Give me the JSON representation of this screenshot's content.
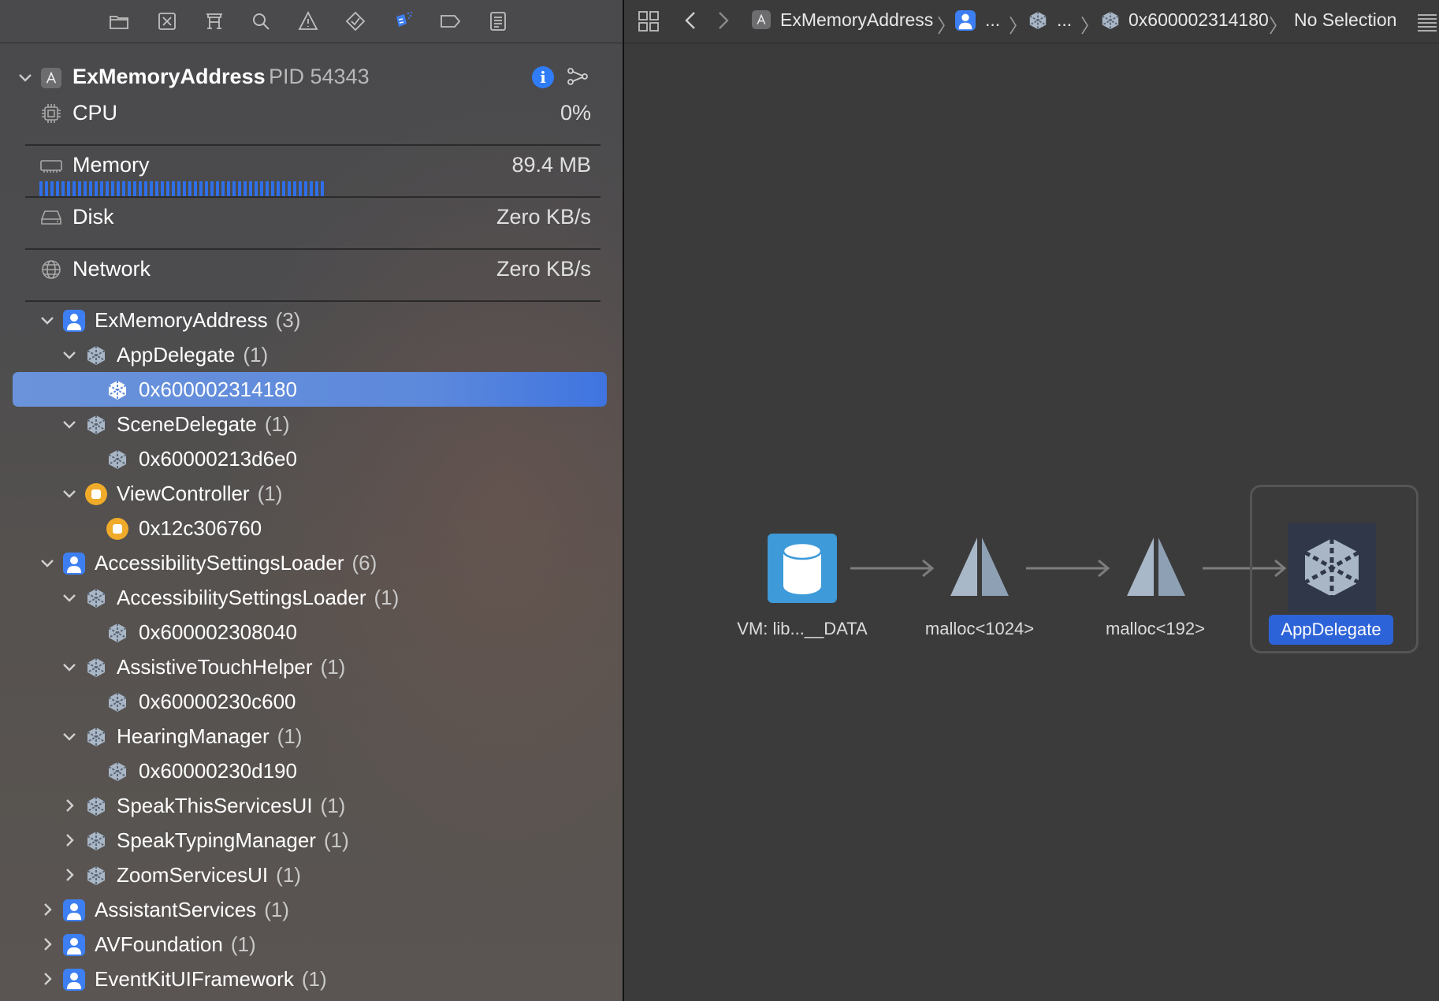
{
  "process": {
    "name": "ExMemoryAddress",
    "pid": "PID 54343",
    "info_glyph": "i"
  },
  "gauges": {
    "cpu": {
      "label": "CPU",
      "value": "0%"
    },
    "memory": {
      "label": "Memory",
      "value": "89.4 MB"
    },
    "disk": {
      "label": "Disk",
      "value": "Zero KB/s"
    },
    "network": {
      "label": "Network",
      "value": "Zero KB/s"
    }
  },
  "navigator_icons": [
    "folder-icon",
    "source-control-icon",
    "symbol-icon",
    "find-icon",
    "issue-icon",
    "test-icon",
    "debug-icon",
    "breakpoint-icon",
    "report-icon"
  ],
  "tree": {
    "r0": {
      "label": "ExMemoryAddress",
      "count": "(3)"
    },
    "r1": {
      "label": "AppDelegate",
      "count": "(1)"
    },
    "r2": {
      "label": "0x600002314180"
    },
    "r3": {
      "label": "SceneDelegate",
      "count": "(1)"
    },
    "r4": {
      "label": "0x60000213d6e0"
    },
    "r5": {
      "label": "ViewController",
      "count": "(1)"
    },
    "r6": {
      "label": "0x12c306760"
    },
    "r7": {
      "label": "AccessibilitySettingsLoader",
      "count": "(6)"
    },
    "r8": {
      "label": "AccessibilitySettingsLoader",
      "count": "(1)"
    },
    "r9": {
      "label": "0x600002308040"
    },
    "r10": {
      "label": "AssistiveTouchHelper",
      "count": "(1)"
    },
    "r11": {
      "label": "0x60000230c600"
    },
    "r12": {
      "label": "HearingManager",
      "count": "(1)"
    },
    "r13": {
      "label": "0x60000230d190"
    },
    "r14": {
      "label": "SpeakThisServicesUI",
      "count": "(1)"
    },
    "r15": {
      "label": "SpeakTypingManager",
      "count": "(1)"
    },
    "r16": {
      "label": "ZoomServicesUI",
      "count": "(1)"
    },
    "r17": {
      "label": "AssistantServices",
      "count": "(1)"
    },
    "r18": {
      "label": "AVFoundation",
      "count": "(1)"
    },
    "r19": {
      "label": "EventKitUIFramework",
      "count": "(1)"
    }
  },
  "jumpbar": {
    "app": "ExMemoryAddress",
    "ellipsis1": "...",
    "ellipsis2": "...",
    "address": "0x600002314180",
    "selection": "No Selection"
  },
  "graph": {
    "nodes": {
      "n0": {
        "label": "VM: lib...__DATA",
        "icon": "database-icon"
      },
      "n1": {
        "label": "malloc<1024>",
        "icon": "malloc-icon"
      },
      "n2": {
        "label": "malloc<192>",
        "icon": "malloc-icon"
      },
      "n3": {
        "label": "AppDelegate",
        "icon": "object-cube-icon"
      }
    }
  },
  "colors": {
    "accent": "#2f7cf6",
    "selection": "#5d89dc",
    "module_icon": "#3d7ff2",
    "swift_class_icon": "#f0ab2a"
  }
}
